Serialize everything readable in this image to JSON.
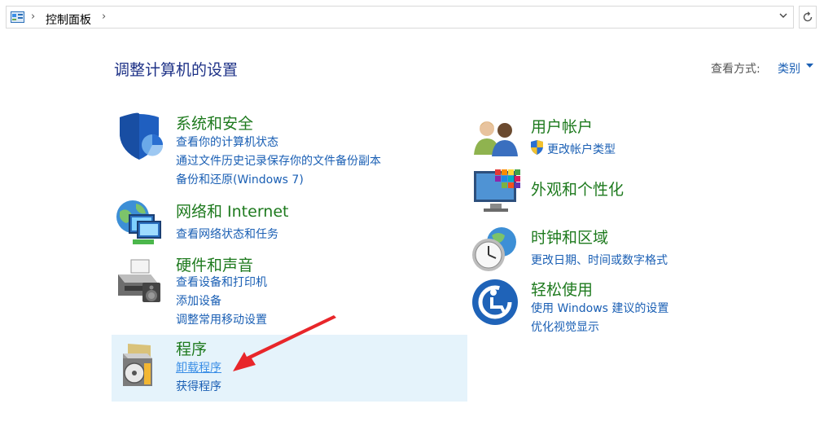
{
  "address": {
    "crumb": "控制面板",
    "sep": "›"
  },
  "header": {
    "title": "调整计算机的设置",
    "view_label": "查看方式:",
    "view_value": "类别"
  },
  "left": [
    {
      "title": "系统和安全",
      "links": [
        "查看你的计算机状态",
        "通过文件历史记录保存你的文件备份副本",
        "备份和还原(Windows 7)"
      ]
    },
    {
      "title": "网络和 Internet",
      "links": [
        "查看网络状态和任务"
      ]
    },
    {
      "title": "硬件和声音",
      "links": [
        "查看设备和打印机",
        "添加设备",
        "调整常用移动设置"
      ]
    },
    {
      "title": "程序",
      "links": [
        "卸载程序",
        "获得程序"
      ]
    }
  ],
  "right": [
    {
      "title": "用户帐户",
      "links": [
        "更改帐户类型"
      ]
    },
    {
      "title": "外观和个性化",
      "links": []
    },
    {
      "title": "时钟和区域",
      "links": [
        "更改日期、时间或数字格式"
      ]
    },
    {
      "title": "轻松使用",
      "links": [
        "使用 Windows 建议的设置",
        "优化视觉显示"
      ]
    }
  ],
  "icons": {
    "address": "control-panel-icon",
    "security": "shield-icon",
    "network": "network-globe-icon",
    "hardware": "printer-icon",
    "programs": "software-box-icon",
    "users": "users-icon",
    "appearance": "display-colors-icon",
    "clock": "clock-globe-icon",
    "ease": "ease-of-access-icon",
    "uac": "uac-shield-icon"
  },
  "colors": {
    "title_blue": "#1e3287",
    "category_green": "#1e7a1e",
    "link_blue": "#1a5fb4",
    "highlight": "#e5f3fb",
    "arrow_red": "#e8262a"
  }
}
